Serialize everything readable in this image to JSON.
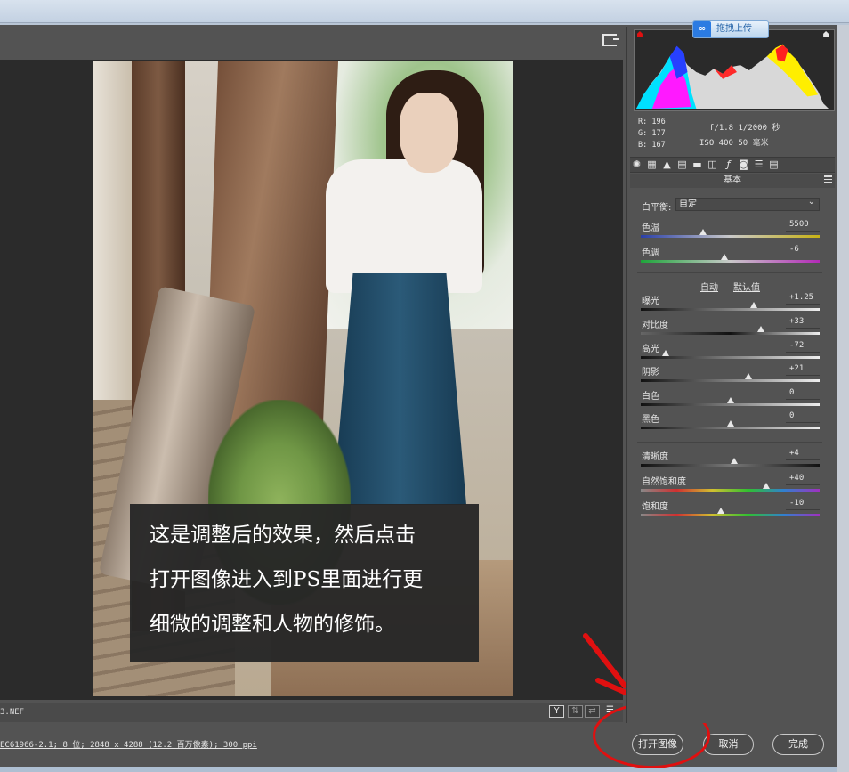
{
  "upload_badge": {
    "icon": "cloud-link-icon",
    "label": "拖拽上传"
  },
  "readout": {
    "r": "R:  196",
    "g": "G:  177",
    "b": "B:  167",
    "exposure_line": "f/1.8  1/2000 秒",
    "iso_line": "ISO 400  50 毫米"
  },
  "panel": {
    "title": "基本",
    "tab_icons": [
      "aperture-icon",
      "tone-curve-icon",
      "mountains-icon",
      "hsl-icon",
      "split-tone-icon",
      "lens-icon",
      "fx-icon",
      "camera-icon",
      "sliders-icon",
      "presets-icon"
    ],
    "white_balance": {
      "label": "白平衡:",
      "value": "自定"
    },
    "auto_label": "自动",
    "default_label": "默认值",
    "sliders": [
      {
        "key": "temperature",
        "label": "色温",
        "value": "5500",
        "pos": 0.35
      },
      {
        "key": "tint",
        "label": "色调",
        "value": "-6",
        "pos": 0.47
      },
      {
        "key": "exposure",
        "label": "曝光",
        "value": "+1.25",
        "pos": 0.63
      },
      {
        "key": "contrast",
        "label": "对比度",
        "value": "+33",
        "pos": 0.67
      },
      {
        "key": "highlights",
        "label": "高光",
        "value": "-72",
        "pos": 0.14
      },
      {
        "key": "shadows",
        "label": "阴影",
        "value": "+21",
        "pos": 0.6
      },
      {
        "key": "whites",
        "label": "白色",
        "value": "0",
        "pos": 0.5
      },
      {
        "key": "blacks",
        "label": "黑色",
        "value": "0",
        "pos": 0.5
      },
      {
        "key": "clarity",
        "label": "清晰度",
        "value": "+4",
        "pos": 0.52
      },
      {
        "key": "vibrance",
        "label": "自然饱和度",
        "value": "+40",
        "pos": 0.7
      },
      {
        "key": "saturation",
        "label": "饱和度",
        "value": "-10",
        "pos": 0.45
      }
    ]
  },
  "caption": {
    "line1": "这是调整后的效果，然后点击",
    "line2": "打开图像进入到PS里面进行更",
    "line3": "细微的调整和人物的修饰。"
  },
  "filmstrip": {
    "filename": "3.NEF",
    "y_button": "Y"
  },
  "footer": {
    "info": "EC61966-2.1; 8 位; 2848 x 4288 (12.2 百万像素); 300 ppi",
    "open_image": "打开图像",
    "cancel": "取消",
    "done": "完成"
  },
  "colors": {
    "panel_bg": "#535353",
    "canvas_bg": "#2b2b2b",
    "annotation_red": "#e01010"
  }
}
